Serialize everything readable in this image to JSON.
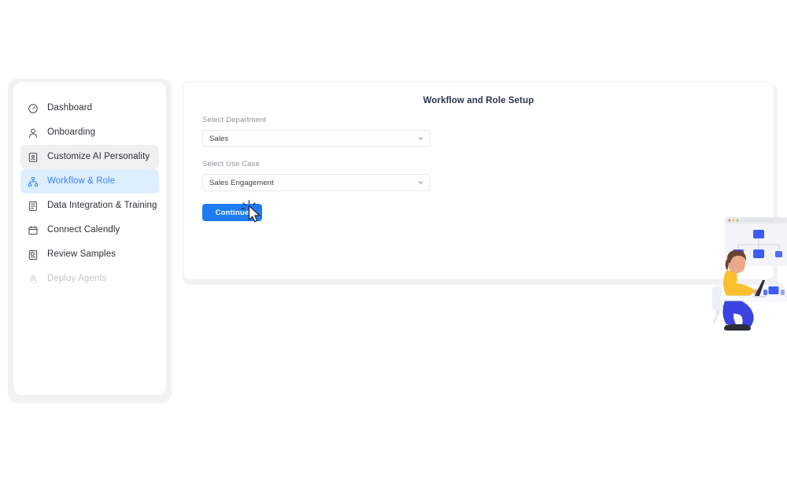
{
  "sidebar": {
    "items": [
      {
        "label": "Dashboard",
        "icon": "gauge-icon",
        "state": "default"
      },
      {
        "label": "Onboarding",
        "icon": "person-icon",
        "state": "default"
      },
      {
        "label": "Customize AI Personality",
        "icon": "id-card-icon",
        "state": "hover"
      },
      {
        "label": "Workflow & Role",
        "icon": "hierarchy-icon",
        "state": "active"
      },
      {
        "label": "Data Integration & Training",
        "icon": "server-icon",
        "state": "default"
      },
      {
        "label": "Connect Calendly",
        "icon": "calendar-icon",
        "state": "default"
      },
      {
        "label": "Review Samples",
        "icon": "document-image-icon",
        "state": "default"
      },
      {
        "label": "Deploy Agents",
        "icon": "rocket-icon",
        "state": "disabled"
      }
    ]
  },
  "panel": {
    "title": "Workflow and Role Setup",
    "form": {
      "department": {
        "label": "Select Department",
        "value": "Sales",
        "caret_icon": "chevron-down-icon"
      },
      "use_case": {
        "label": "Select Use Case",
        "value": "Sales Engagement",
        "caret_icon": "chevron-down-icon"
      },
      "continue_label": "Continue"
    },
    "illustration": {
      "name": "two-people-at-desk-with-workflow-and-calendar-illustration"
    }
  },
  "cursor": {
    "name": "mouse-pointer-click"
  },
  "colors": {
    "accent": "#1d7cf2",
    "active_nav_bg": "#ddeeff",
    "active_nav_text": "#3b82f6",
    "hover_nav_bg": "#f0f0f1",
    "title_text": "#2b3550",
    "label_text": "#8d9196",
    "body_text": "#2b3034",
    "disabled_text": "#c3c6c9",
    "card_bg": "#ffffff",
    "card_backdrop": "#f2f2f3",
    "page_bg": "#ffffff",
    "illustration_blue": "#3d5afe",
    "illustration_yellow": "#fbc02d",
    "illustration_green": "#2eb872",
    "illustration_purple": "#8e2de2"
  }
}
